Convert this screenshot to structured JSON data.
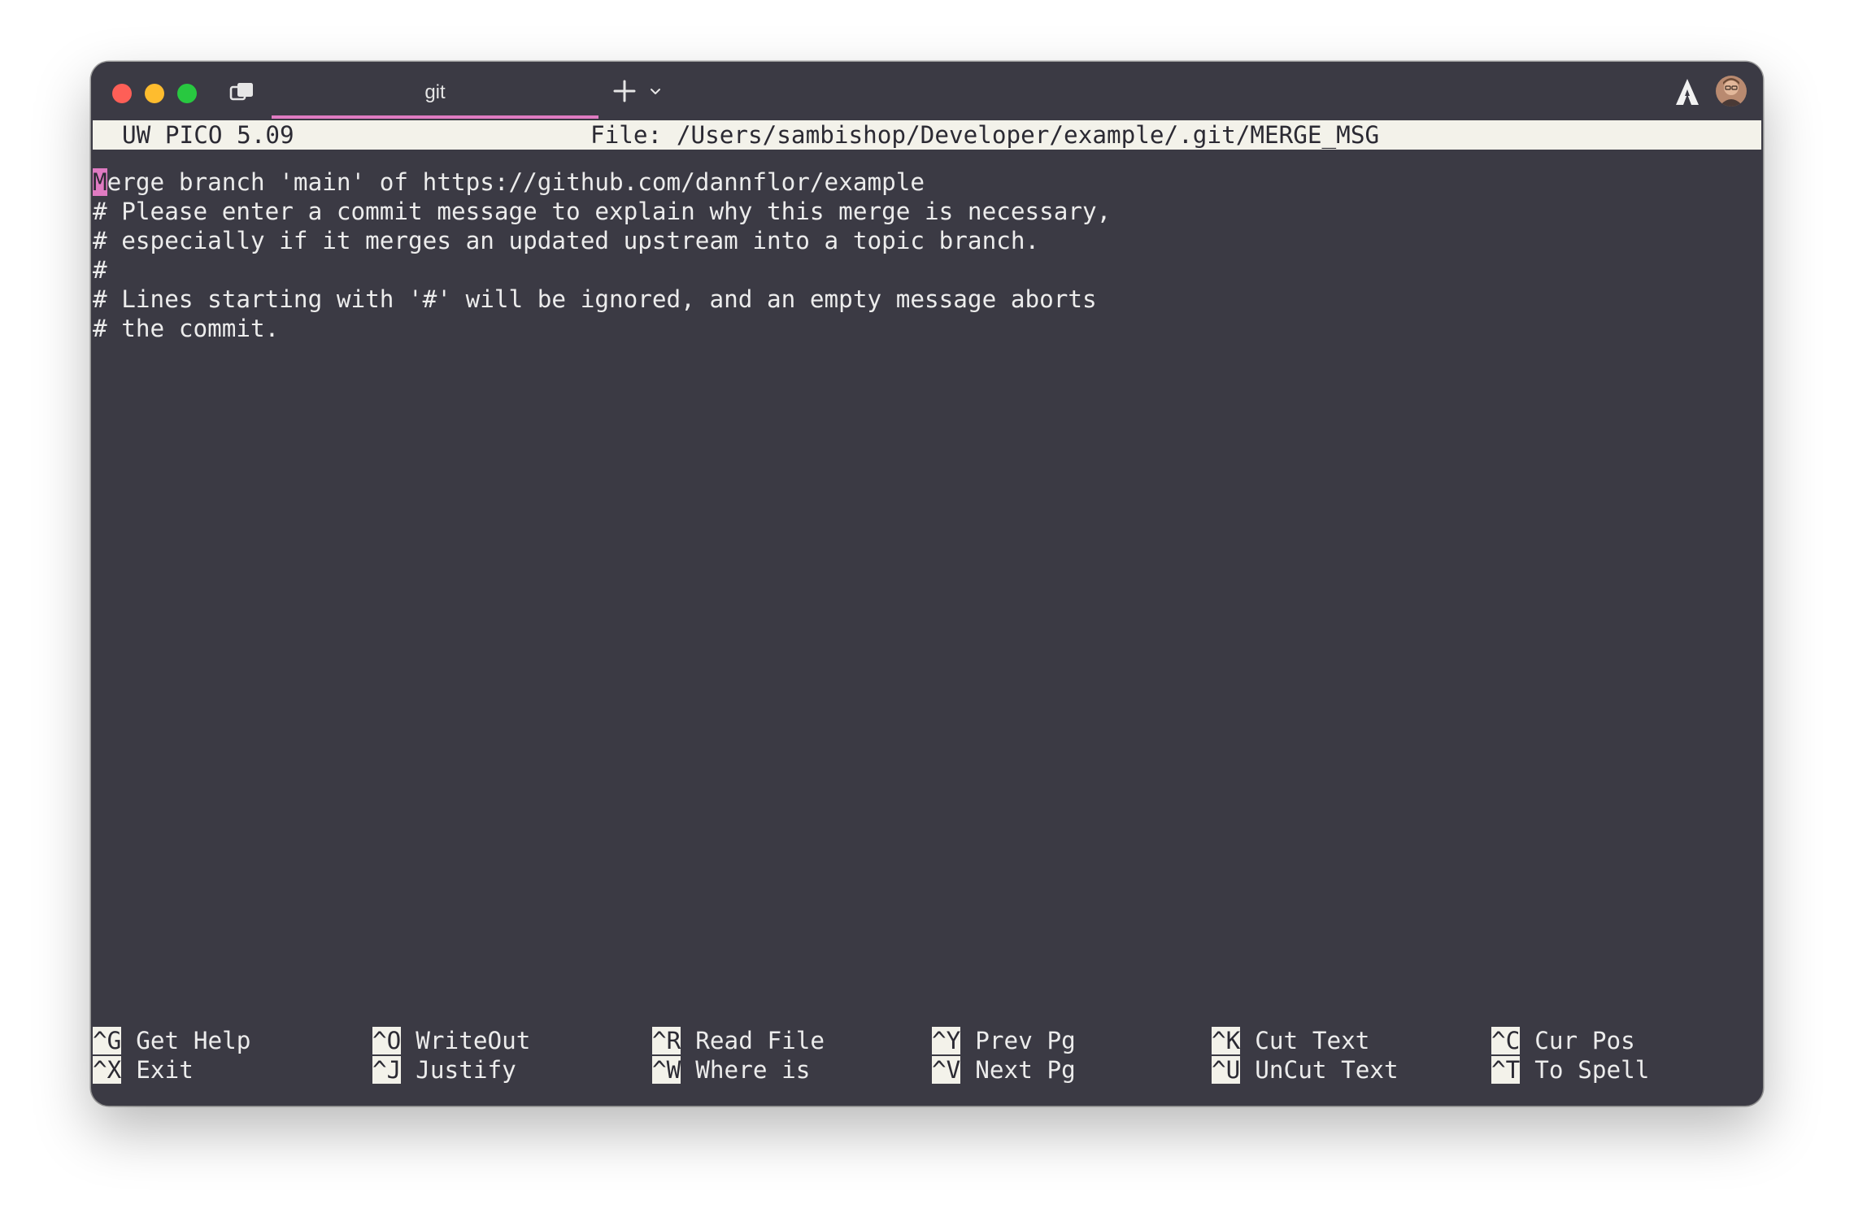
{
  "window": {
    "tab_title": "git"
  },
  "icons": {
    "overview": "tab-overview-icon",
    "new_tab": "plus-icon",
    "tab_menu": "chevron-down-icon",
    "app_logo": "warp-logo-icon",
    "avatar": "user-avatar"
  },
  "colors": {
    "accent": "#e07bc2",
    "background": "#3b3a44",
    "status_bar": "#f3f2ea"
  },
  "status": {
    "app": "UW PICO 5.09",
    "file": "File: /Users/sambishop/Developer/example/.git/MERGE_MSG"
  },
  "editor": {
    "cursor_char": "M",
    "first_line_rest": "erge branch 'main' of https://github.com/dannflor/example",
    "lines": [
      "# Please enter a commit message to explain why this merge is necessary,",
      "# especially if it merges an updated upstream into a topic branch.",
      "#",
      "# Lines starting with '#' will be ignored, and an empty message aborts",
      "# the commit."
    ]
  },
  "shortcuts": [
    {
      "key": "^G",
      "label": "Get Help"
    },
    {
      "key": "^X",
      "label": "Exit"
    },
    {
      "key": "^O",
      "label": "WriteOut"
    },
    {
      "key": "^J",
      "label": "Justify"
    },
    {
      "key": "^R",
      "label": "Read File"
    },
    {
      "key": "^W",
      "label": "Where is"
    },
    {
      "key": "^Y",
      "label": "Prev Pg"
    },
    {
      "key": "^V",
      "label": "Next Pg"
    },
    {
      "key": "^K",
      "label": "Cut Text"
    },
    {
      "key": "^U",
      "label": "UnCut Text"
    },
    {
      "key": "^C",
      "label": "Cur Pos"
    },
    {
      "key": "^T",
      "label": "To Spell"
    }
  ]
}
